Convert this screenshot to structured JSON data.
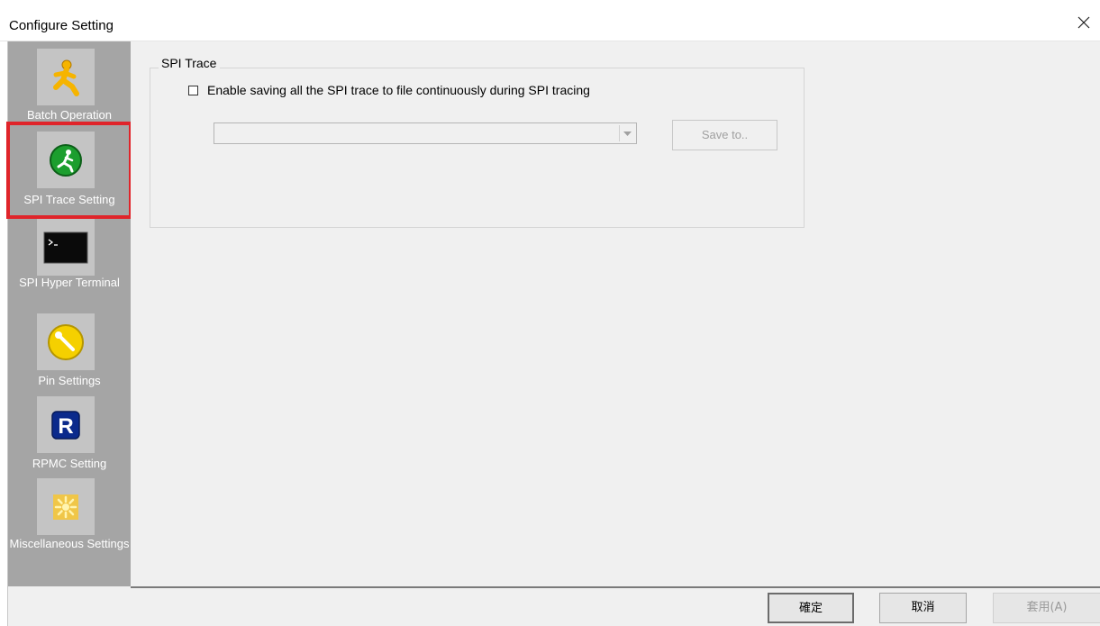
{
  "window": {
    "title": "Configure Setting",
    "close_icon": "close-icon"
  },
  "sidebar": {
    "items": [
      {
        "label": "Batch Operation",
        "icon": "running-person-icon",
        "selected": false
      },
      {
        "label": "SPI Trace Setting",
        "icon": "green-runner-icon",
        "selected": true
      },
      {
        "label": "SPI Hyper Terminal",
        "icon": "terminal-icon",
        "selected": false
      },
      {
        "label": "Pin Settings",
        "icon": "wrench-icon",
        "selected": false
      },
      {
        "label": "RPMC Setting",
        "icon": "r-badge-icon",
        "selected": false
      },
      {
        "label": "Miscellaneous Settings",
        "icon": "flower-icon",
        "selected": false
      }
    ]
  },
  "main": {
    "group_title": "SPI Trace",
    "checkbox_label": "Enable saving all the SPI trace to file continuously during SPI tracing",
    "checkbox_checked": false,
    "path_value": "",
    "save_to_label": "Save to.."
  },
  "footer": {
    "ok_label": "確定",
    "cancel_label": "取消",
    "apply_label": "套用(A)"
  },
  "colors": {
    "sidebar_bg": "#a5a5a5",
    "selection_outline": "#e0242a",
    "dialog_bg": "#f0f0f0"
  }
}
